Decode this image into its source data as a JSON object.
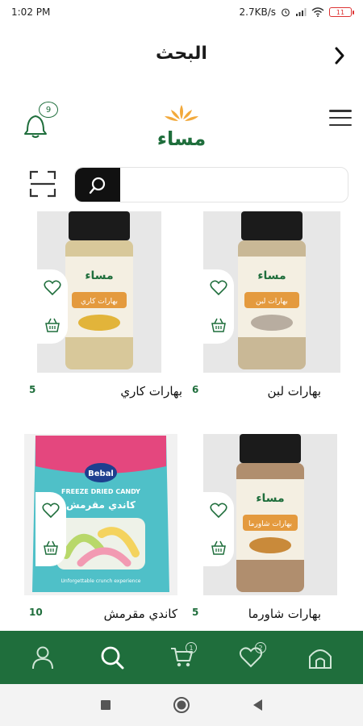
{
  "status_bar": {
    "time": "1:02 PM",
    "network_speed": "2.7KB/s",
    "battery": "11"
  },
  "title_bar": {
    "title": "البحث",
    "back_icon": "chevron-right-icon"
  },
  "header": {
    "notification_count": "9",
    "logo_text": "مساء",
    "menu_icon": "hamburger-icon"
  },
  "search": {
    "placeholder": "",
    "value": ""
  },
  "products": [
    {
      "name": "بهارات لبن",
      "count": "6",
      "label_text": "بهارات لبن"
    },
    {
      "name": "بهارات كاري",
      "count": "5",
      "label_text": "بهارات كاري"
    },
    {
      "name": "بهارات شاورما",
      "count": "5",
      "label_text": "بهارات شاورما"
    },
    {
      "name": "كاندي مقرمش",
      "count": "10",
      "brand": "Bebal",
      "subtitle": "FREEZE DRIED CANDY",
      "label_text": "كاندي مقرمش",
      "tagline": "Unforgettable crunch experience"
    }
  ],
  "bottom_nav": [
    {
      "icon": "user-icon"
    },
    {
      "icon": "search-icon"
    },
    {
      "icon": "cart-icon",
      "badge": "1"
    },
    {
      "icon": "heart-icon",
      "badge": "2"
    },
    {
      "icon": "home-icon"
    }
  ],
  "colors": {
    "primary": "#1f6e3c",
    "accent": "#f2a93b"
  }
}
